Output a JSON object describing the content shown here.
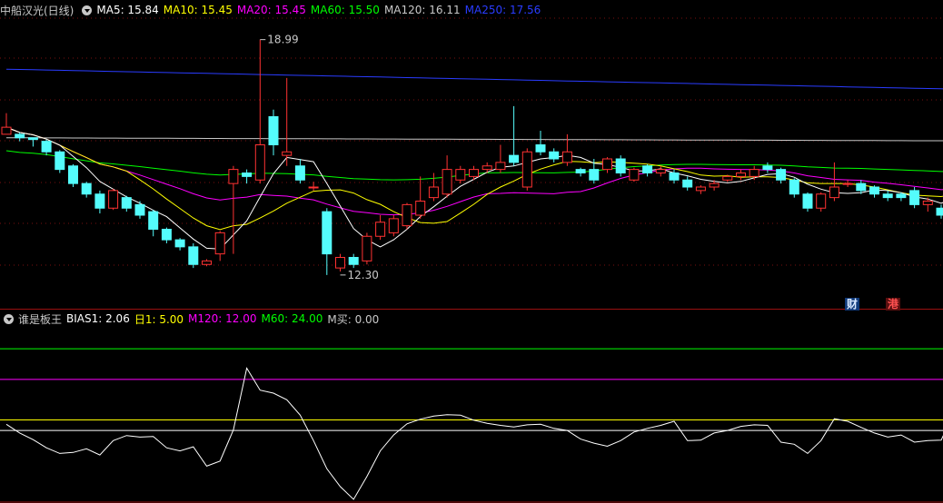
{
  "main_header": {
    "title": "中船汉光(日线)",
    "indicators": [
      {
        "label": "MA5: 15.84",
        "color": "#ffffff"
      },
      {
        "label": "MA10: 15.45",
        "color": "#ffff00"
      },
      {
        "label": "MA20: 15.45",
        "color": "#ff00ff"
      },
      {
        "label": "MA60: 15.50",
        "color": "#00ff00"
      },
      {
        "label": "MA120: 16.11",
        "color": "#c8c8c8"
      },
      {
        "label": "MA250: 17.56",
        "color": "#2a3cff"
      }
    ]
  },
  "sub_header": {
    "title": "谁是板王",
    "indicators": [
      {
        "label": "BIAS1: 2.06",
        "color": "#ffffff"
      },
      {
        "label": "日1: 5.00",
        "color": "#ffff00"
      },
      {
        "label": "M120: 12.00",
        "color": "#ff00ff"
      },
      {
        "label": "M60: 24.00",
        "color": "#00ff00"
      },
      {
        "label": "M买: 0.00",
        "color": "#c8c8c8"
      }
    ]
  },
  "badges": {
    "cai": "财",
    "gang": "港"
  },
  "colors": {
    "up": "#ff3232",
    "down": "#54fcfc",
    "ma5": "#ffffff",
    "ma10": "#ffff00",
    "ma20": "#ff00ff",
    "ma60": "#00ff00",
    "ma120": "#c8c8c8",
    "ma250": "#2a3cff",
    "grid": "#7a1010"
  },
  "chart_data": [
    {
      "type": "candlestick",
      "price_range": [
        11.6,
        19.6
      ],
      "annotations": [
        {
          "text": "18.99",
          "price": 18.99,
          "candle_index": 19
        },
        {
          "text": "12.30",
          "price": 12.3,
          "candle_index": 25
        }
      ],
      "candles": [
        [
          16.3,
          16.5,
          16.9,
          16.3
        ],
        [
          16.3,
          16.2,
          16.35,
          16.1
        ],
        [
          16.2,
          16.15,
          16.2,
          15.95
        ],
        [
          16.1,
          15.8,
          16.15,
          15.7
        ],
        [
          15.8,
          15.3,
          15.85,
          15.2
        ],
        [
          15.4,
          14.9,
          15.45,
          14.8
        ],
        [
          14.9,
          14.6,
          14.95,
          14.5
        ],
        [
          14.6,
          14.2,
          14.7,
          14.05
        ],
        [
          14.2,
          14.7,
          14.75,
          14.15
        ],
        [
          14.5,
          14.2,
          14.55,
          14.1
        ],
        [
          14.3,
          14.0,
          14.4,
          13.9
        ],
        [
          14.1,
          13.6,
          14.15,
          13.4
        ],
        [
          13.6,
          13.3,
          13.65,
          13.2
        ],
        [
          13.3,
          13.1,
          13.35,
          13.0
        ],
        [
          13.1,
          12.6,
          13.2,
          12.5
        ],
        [
          12.6,
          12.7,
          12.75,
          12.55
        ],
        [
          12.9,
          13.5,
          13.55,
          12.7
        ],
        [
          14.9,
          15.3,
          15.4,
          12.9
        ],
        [
          15.2,
          15.1,
          15.3,
          14.9
        ],
        [
          15.0,
          16.0,
          18.99,
          14.9
        ],
        [
          16.8,
          16.0,
          17.0,
          15.7
        ],
        [
          15.7,
          15.8,
          17.9,
          15.4
        ],
        [
          15.4,
          15.0,
          15.6,
          14.9
        ],
        [
          14.8,
          14.8,
          14.95,
          14.7
        ],
        [
          14.1,
          12.9,
          14.2,
          12.3
        ],
        [
          12.5,
          12.8,
          12.9,
          12.4
        ],
        [
          12.8,
          12.6,
          12.9,
          12.5
        ],
        [
          12.7,
          13.4,
          13.5,
          12.6
        ],
        [
          13.4,
          13.8,
          14.0,
          13.3
        ],
        [
          13.5,
          13.9,
          14.0,
          13.4
        ],
        [
          13.7,
          14.3,
          14.35,
          13.6
        ],
        [
          14.0,
          14.4,
          15.1,
          13.9
        ],
        [
          14.5,
          14.8,
          15.2,
          14.4
        ],
        [
          14.6,
          15.3,
          15.7,
          14.5
        ],
        [
          15.0,
          15.3,
          15.4,
          14.9
        ],
        [
          15.1,
          15.3,
          15.4,
          15.0
        ],
        [
          15.3,
          15.4,
          15.5,
          15.2
        ],
        [
          15.3,
          15.5,
          16.0,
          15.2
        ],
        [
          15.7,
          15.5,
          17.1,
          15.4
        ],
        [
          14.8,
          15.8,
          15.9,
          14.7
        ],
        [
          16.0,
          15.8,
          16.4,
          15.7
        ],
        [
          15.8,
          15.6,
          15.9,
          15.5
        ],
        [
          15.5,
          15.8,
          16.3,
          15.4
        ],
        [
          15.3,
          15.2,
          15.35,
          15.1
        ],
        [
          15.3,
          15.0,
          15.6,
          14.9
        ],
        [
          15.3,
          15.6,
          15.65,
          15.2
        ],
        [
          15.6,
          15.2,
          15.7,
          15.1
        ],
        [
          15.0,
          15.3,
          15.35,
          14.95
        ],
        [
          15.4,
          15.2,
          15.45,
          15.1
        ],
        [
          15.2,
          15.3,
          15.4,
          15.1
        ],
        [
          15.2,
          15.0,
          15.3,
          14.9
        ],
        [
          15.0,
          14.8,
          15.1,
          14.7
        ],
        [
          14.7,
          14.8,
          14.85,
          14.6
        ],
        [
          14.8,
          14.9,
          15.0,
          14.7
        ],
        [
          15.0,
          15.1,
          15.15,
          14.95
        ],
        [
          15.1,
          15.2,
          15.3,
          15.0
        ],
        [
          15.1,
          15.3,
          15.4,
          15.0
        ],
        [
          15.4,
          15.3,
          15.5,
          15.2
        ],
        [
          15.3,
          15.0,
          15.35,
          14.9
        ],
        [
          15.0,
          14.6,
          15.05,
          14.5
        ],
        [
          14.6,
          14.2,
          14.65,
          14.1
        ],
        [
          14.2,
          14.6,
          14.65,
          14.1
        ],
        [
          14.5,
          14.8,
          15.5,
          14.4
        ],
        [
          14.9,
          14.9,
          15.0,
          14.8
        ],
        [
          14.9,
          14.7,
          15.0,
          14.6
        ],
        [
          14.8,
          14.6,
          14.85,
          14.5
        ],
        [
          14.6,
          14.5,
          14.7,
          14.4
        ],
        [
          14.6,
          14.5,
          14.65,
          14.4
        ],
        [
          14.7,
          14.3,
          14.8,
          14.2
        ],
        [
          14.3,
          14.4,
          14.5,
          14.1
        ],
        [
          14.2,
          14.0,
          14.3,
          13.9
        ],
        [
          14.1,
          15.2,
          16.2,
          14.0
        ],
        [
          15.5,
          15.7,
          15.8,
          15.3
        ],
        [
          15.2,
          16.0,
          16.5,
          15.1
        ],
        [
          15.7,
          16.0,
          16.4,
          15.5
        ]
      ]
    },
    {
      "type": "line",
      "name": "BIAS1",
      "ylim": [
        -13.5,
        21
      ],
      "reference_lines": [
        {
          "value": 16,
          "color": "#00ff00"
        },
        {
          "value": 10,
          "color": "#ff00ff"
        },
        {
          "value": 2.06,
          "color": "#ffff00"
        },
        {
          "value": 0,
          "color": "#ffffff"
        }
      ],
      "values": [
        1.2,
        -0.5,
        -1.8,
        -3.4,
        -4.5,
        -4.3,
        -3.6,
        -4.8,
        -2.0,
        -1.0,
        -1.3,
        -1.2,
        -3.4,
        -4.0,
        -3.2,
        -7.0,
        -6.0,
        0.1,
        12.2,
        7.9,
        7.3,
        6.0,
        3.0,
        -2.0,
        -7.5,
        -11.0,
        -13.5,
        -9.0,
        -4.0,
        -0.9,
        1.3,
        2.2,
        2.8,
        3.1,
        3.0,
        2.0,
        1.4,
        1.0,
        0.7,
        1.1,
        1.2,
        0.4,
        0.0,
        -1.7,
        -2.5,
        -3.1,
        -2.0,
        -0.3,
        0.4,
        1.0,
        1.8,
        -2.0,
        -1.9,
        -0.5,
        0.0,
        0.8,
        1.1,
        1.0,
        -2.3,
        -2.7,
        -4.5,
        -2.0,
        2.3,
        1.8,
        0.6,
        -0.5,
        -1.3,
        -0.9,
        -2.3,
        -2.0,
        -1.9,
        3.8,
        1.3,
        3.1,
        0.8
      ]
    }
  ]
}
